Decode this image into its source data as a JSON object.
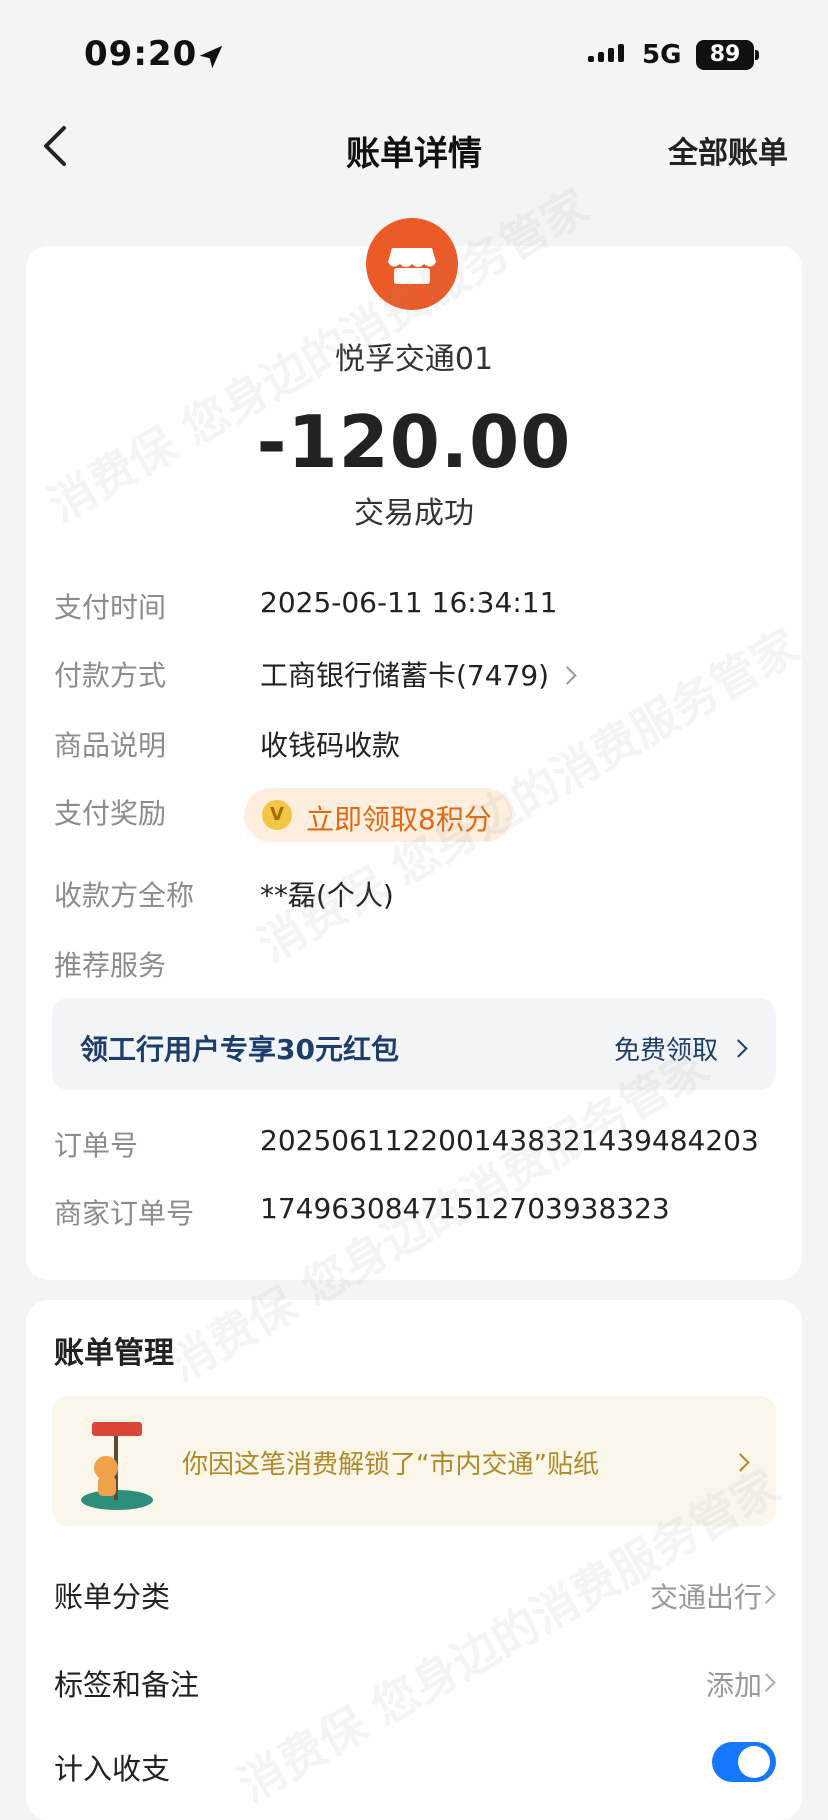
{
  "status_bar": {
    "time": "09:20",
    "network": "5G",
    "battery": "89"
  },
  "nav": {
    "title": "账单详情",
    "right_link": "全部账单"
  },
  "transaction": {
    "merchant": "悦孚交通01",
    "amount": "-120.00",
    "status": "交易成功",
    "brand_color": "#ec5a27"
  },
  "details": {
    "pay_time_label": "支付时间",
    "pay_time": "2025-06-11 16:34:11",
    "pay_method_label": "付款方式",
    "pay_method": "工商银行储蓄卡(7479)",
    "description_label": "商品说明",
    "description": "收钱码收款",
    "reward_label": "支付奖励",
    "reward_text": "立即领取8积分",
    "payee_label": "收款方全称",
    "payee": "**磊(个人)",
    "recommend_label": "推荐服务",
    "promo_text": "领工行用户专享30元红包",
    "promo_link": "免费领取",
    "order_no_label": "订单号",
    "order_no": "2025061122001438321439484203",
    "merchant_order_label": "商家订单号",
    "merchant_order": "17496308471512703938323"
  },
  "management": {
    "title": "账单管理",
    "sticker_text": "你因这笔消费解锁了“市内交通”贴纸",
    "category_label": "账单分类",
    "category_value": "交通出行",
    "tags_label": "标签和备注",
    "tags_value": "添加",
    "include_label": "计入收支",
    "include_enabled": true
  },
  "watermark": "消费保 您身边的消费服务管家"
}
